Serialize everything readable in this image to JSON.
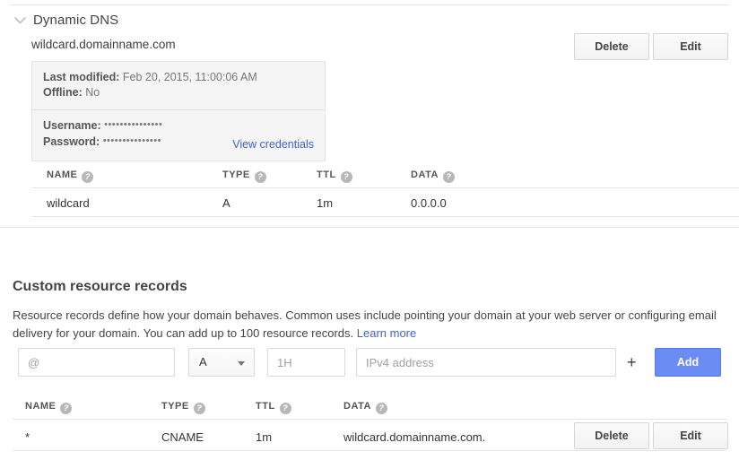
{
  "dynamic_dns": {
    "section_title": "Dynamic DNS",
    "chevron_icon": "chevron-down-icon",
    "domain": "wildcard.domainname.com",
    "delete_label": "Delete",
    "edit_label": "Edit",
    "credentials": {
      "last_modified_label": "Last modified:",
      "last_modified_value": "Feb 20, 2015, 11:00:06 AM",
      "offline_label": "Offline:",
      "offline_value": "No",
      "username_label": "Username:",
      "username_value": "•••••••••••••••",
      "password_label": "Password:",
      "password_value": "•••••••••••••••",
      "view_credentials_label": "View credentials"
    },
    "table": {
      "columns": [
        {
          "label": "NAME",
          "help_icon": "help-icon"
        },
        {
          "label": "TYPE",
          "help_icon": "help-icon"
        },
        {
          "label": "TTL",
          "help_icon": "help-icon"
        },
        {
          "label": "DATA",
          "help_icon": "help-icon"
        }
      ],
      "rows": [
        {
          "name": "wildcard",
          "type": "A",
          "ttl": "1m",
          "data": "0.0.0.0"
        }
      ]
    }
  },
  "custom_records": {
    "title": "Custom resource records",
    "description": "Resource records define how your domain behaves. Common uses include pointing your domain at your web server or configuring email delivery for your domain. You can add up to 100 resource records.",
    "learn_more_label": "Learn more",
    "form": {
      "name_placeholder": "@",
      "name_value": "",
      "type_selected": "A",
      "type_caret_icon": "caret-down-icon",
      "ttl_placeholder": "1H",
      "ttl_value": "",
      "data_placeholder": "IPv4 address",
      "data_value": "",
      "add_more_icon": "plus-icon",
      "add_button_label": "Add"
    },
    "table": {
      "columns": [
        {
          "label": "NAME",
          "help_icon": "help-icon"
        },
        {
          "label": "TYPE",
          "help_icon": "help-icon"
        },
        {
          "label": "TTL",
          "help_icon": "help-icon"
        },
        {
          "label": "DATA",
          "help_icon": "help-icon"
        }
      ],
      "rows": [
        {
          "name": "*",
          "type": "CNAME",
          "ttl": "1m",
          "data": "wildcard.domainname.com.",
          "delete_label": "Delete",
          "edit_label": "Edit"
        }
      ]
    }
  },
  "colors": {
    "accent_blue": "#6b8cf2",
    "link_blue": "#4261c4",
    "card_bg": "#f5f5f5",
    "border": "#e6e6e6",
    "help_icon": "#b7b7b7"
  }
}
